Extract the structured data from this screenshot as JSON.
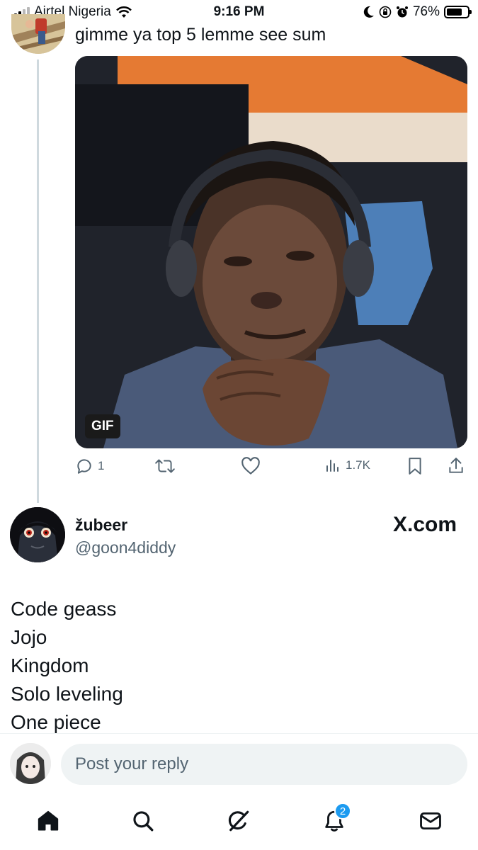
{
  "status_bar": {
    "carrier": "Airtel Nigeria",
    "time": "9:16 PM",
    "battery": "76%",
    "battery_level": 0.76
  },
  "parent_tweet": {
    "text": "gimme ya top 5 lemme see sum",
    "media_badge": "GIF",
    "actions": {
      "reply_count": "1",
      "views": "1.7K"
    }
  },
  "reply_tweet": {
    "display_name": "žubeer",
    "handle": "@goon4diddy",
    "source_label": "X.com",
    "lines": [
      "Code geass",
      "Jojo",
      "Kingdom",
      "Solo leveling",
      "One piece"
    ]
  },
  "composer": {
    "placeholder": "Post your reply"
  },
  "bottom_nav": {
    "notifications_badge": "2"
  },
  "colors": {
    "accent": "#1d9bf0",
    "secondary_text": "#536471",
    "text": "#0f1419"
  }
}
